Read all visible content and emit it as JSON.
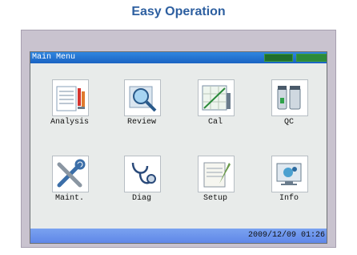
{
  "heading": "Easy Operation",
  "window": {
    "title": "Main Menu"
  },
  "menu": [
    {
      "label": "Analysis",
      "icon": "analysis-icon"
    },
    {
      "label": "Review",
      "icon": "review-icon"
    },
    {
      "label": "Cal",
      "icon": "cal-icon"
    },
    {
      "label": "QC",
      "icon": "qc-icon"
    },
    {
      "label": "Maint.",
      "icon": "maint-icon"
    },
    {
      "label": "Diag",
      "icon": "diag-icon"
    },
    {
      "label": "Setup",
      "icon": "setup-icon"
    },
    {
      "label": "Info",
      "icon": "info-icon"
    }
  ],
  "status": {
    "datetime": "2009/12/09  01:26"
  },
  "colors": {
    "title_bar": "#1a63c2",
    "status_bar": "#6d92ea",
    "heading": "#2d5fa0",
    "indicator": "#2c8a3a"
  }
}
